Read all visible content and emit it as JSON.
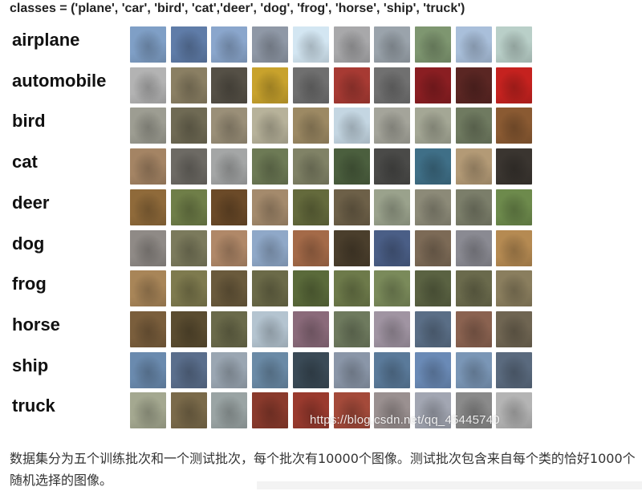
{
  "heading": "classes = ('plane', 'car', 'bird', 'cat','deer', 'dog', 'frog', 'horse', 'ship', 'truck')",
  "rows": [
    {
      "label": "airplane",
      "colors": [
        "#7f9fc6",
        "#5f7ca8",
        "#8aa6cc",
        "#8f98a6",
        "#d3e6f2",
        "#a8a8aa",
        "#9aa3ab",
        "#7e9670",
        "#a9bfda",
        "#b9cfc8"
      ]
    },
    {
      "label": "automobile",
      "colors": [
        "#b3b3b3",
        "#8a7f63",
        "#555046",
        "#c8a22c",
        "#6f6f6f",
        "#a73a33",
        "#707070",
        "#8a1e22",
        "#5a2623",
        "#c5221f"
      ]
    },
    {
      "label": "bird",
      "colors": [
        "#9d9d92",
        "#6f6a54",
        "#9a8f78",
        "#b7b29a",
        "#9c8963",
        "#c4d6e2",
        "#a4a49a",
        "#a4a795",
        "#6f7a60",
        "#8a5a32"
      ]
    },
    {
      "label": "cat",
      "colors": [
        "#a48464",
        "#6d6a64",
        "#a4a6a6",
        "#6d7a55",
        "#808266",
        "#4b5f3e",
        "#4a4a48",
        "#3f6f87",
        "#b39a76",
        "#3a3530"
      ]
    },
    {
      "label": "deer",
      "colors": [
        "#8f6a3a",
        "#6f7e48",
        "#6b4a28",
        "#a48a6c",
        "#646a3c",
        "#6d6048",
        "#9aa28c",
        "#8c8a78",
        "#7b7e6a",
        "#6d8a4c"
      ]
    },
    {
      "label": "dog",
      "colors": [
        "#8f8a86",
        "#7b7a5c",
        "#b08868",
        "#8fa8c8",
        "#a46a48",
        "#4a3e2c",
        "#4a5e86",
        "#7c6a56",
        "#8a8a92",
        "#b58a52"
      ]
    },
    {
      "label": "frog",
      "colors": [
        "#a88558",
        "#7e7a4e",
        "#6a5a3c",
        "#6b6a48",
        "#5a6a3a",
        "#6d7a4a",
        "#7a8a5a",
        "#5a6242",
        "#6a6a4c",
        "#8a7e5e"
      ]
    },
    {
      "label": "horse",
      "colors": [
        "#7a5e3c",
        "#5a4c30",
        "#6a6a4a",
        "#b4c4d0",
        "#8a6a7a",
        "#6e7a5e",
        "#a094a2",
        "#5a6e86",
        "#8a6250",
        "#6f6552"
      ]
    },
    {
      "label": "ship",
      "colors": [
        "#6a8aae",
        "#5a6e8c",
        "#9aa6b2",
        "#6a8aa6",
        "#3a4a56",
        "#8a96a8",
        "#5a7a9a",
        "#6a8ab6",
        "#7a96b6",
        "#5a6a7e"
      ]
    },
    {
      "label": "truck",
      "colors": [
        "#a4a890",
        "#7a6a4a",
        "#9aa4a4",
        "#8a3a2c",
        "#9a3a2e",
        "#a44a3a",
        "#9a9090",
        "#a2a6b2",
        "#8a8a8a",
        "#b4b4b4"
      ]
    }
  ],
  "watermark": "https://blog.csdn.net/qq_45445740",
  "caption": "数据集分为五个训练批次和一个测试批次，每个批次有10000个图像。测试批次包含来自每个类的恰好1000个随机选择的图像。"
}
